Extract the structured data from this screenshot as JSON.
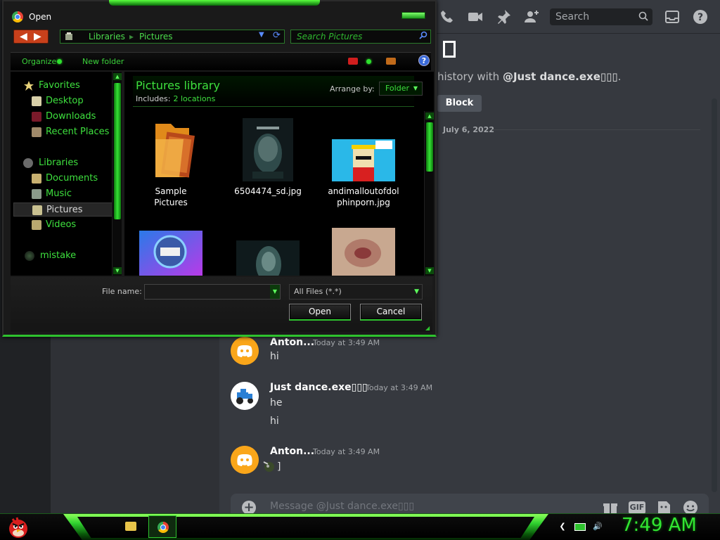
{
  "discord": {
    "search_placeholder": "Search",
    "big_glyph": "▯",
    "history_prefix": "history with",
    "history_user": "@Just dance.exe▯▯▯",
    "history_suffix": ".",
    "block_button": "Block",
    "date_divider": "July 6, 2022",
    "messages": [
      {
        "author": "Anton...",
        "time": "Today at 3:49 AM",
        "lines": [
          "hi"
        ],
        "avatar": "discord-logo"
      },
      {
        "author": "Just dance.exe▯▯▯",
        "time": "Today at 3:49 AM",
        "lines": [
          "he",
          "hi"
        ],
        "avatar": "tractor"
      },
      {
        "author": "Anton...",
        "time": "Today at 3:49 AM",
        "lines": [
          "]"
        ],
        "avatar": "discord-logo"
      }
    ],
    "input_placeholder": "Message @Just dance.exe▯▯▯",
    "gif_label": "GIF",
    "accent": "#faa61a"
  },
  "dialog": {
    "title": "Open",
    "breadcrumb": [
      "Libraries",
      "Pictures"
    ],
    "search_placeholder": "Search Pictures",
    "toolbar": {
      "organize": "Organize",
      "new_folder": "New folder"
    },
    "nav": {
      "favorites": "Favorites",
      "desktop": "Desktop",
      "downloads": "Downloads",
      "recent": "Recent Places",
      "libraries": "Libraries",
      "documents": "Documents",
      "music": "Music",
      "pictures": "Pictures",
      "videos": "Videos",
      "mistake": "mistake"
    },
    "library": {
      "title": "Pictures library",
      "includes_label": "Includes:",
      "includes_link": "2 locations",
      "arrange_label": "Arrange by:",
      "arrange_value": "Folder"
    },
    "files": [
      {
        "name_line1": "Sample",
        "name_line2": "Pictures"
      },
      {
        "name_line1": "6504474_sd.jpg",
        "name_line2": ""
      },
      {
        "name_line1": "andimalloutofdol",
        "name_line2": "phinporn.jpg"
      }
    ],
    "filename_label": "File name:",
    "filename_value": "",
    "filetype": "All Files (*.*)",
    "open_button": "Open",
    "cancel_button": "Cancel",
    "accent": "#2ec22e"
  },
  "taskbar": {
    "clock": "7:49 AM"
  }
}
